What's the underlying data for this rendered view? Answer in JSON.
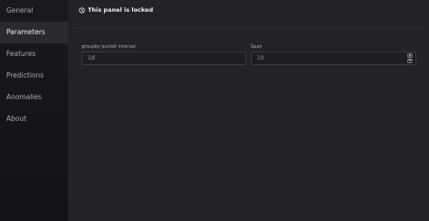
{
  "sidebar": {
    "items": [
      {
        "label": "General",
        "active": false
      },
      {
        "label": "Parameters",
        "active": true
      },
      {
        "label": "Features",
        "active": false
      },
      {
        "label": "Predictions",
        "active": false
      },
      {
        "label": "Anomalies",
        "active": false
      },
      {
        "label": "About",
        "active": false
      }
    ]
  },
  "banner": {
    "text": "This panel is locked",
    "icon": "clock-lock-icon"
  },
  "fields": {
    "groupby": {
      "label": "groupby bucket interval",
      "value": "1d"
    },
    "span": {
      "label": "Span",
      "value": "10",
      "stepper_up": "▲",
      "stepper_down": "▼"
    }
  },
  "colors": {
    "background": "#222228",
    "sidebar": "#16161b",
    "active_item": "#2a2b31",
    "input_border": "#3a3b42"
  }
}
